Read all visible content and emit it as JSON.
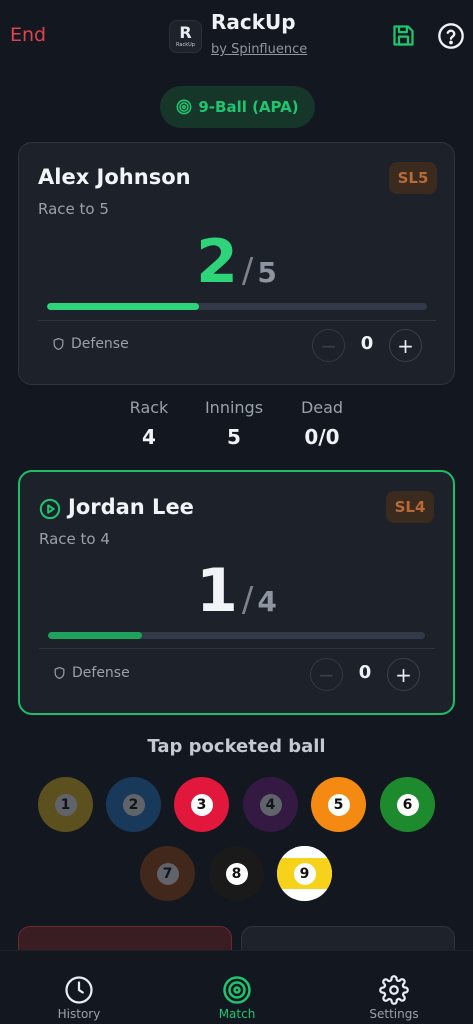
{
  "header": {
    "end_label": "End",
    "logo_text": "R",
    "logo_small": "RackUp",
    "app_title": "RackUp",
    "app_subtitle": "by Spinfluence"
  },
  "game_type": "9-Ball (APA)",
  "player1": {
    "name": "Alex Johnson",
    "skill_level": "SL5",
    "race_label": "Race to 5",
    "score": "2",
    "target": "5",
    "progress": 0.4,
    "defense_label": "Defense",
    "defense_count": "0"
  },
  "player2": {
    "name": "Jordan Lee",
    "skill_level": "SL4",
    "race_label": "Race to 4",
    "score": "1",
    "target": "4",
    "progress": 0.25,
    "defense_label": "Defense",
    "defense_count": "0",
    "active": true
  },
  "stats": {
    "rack_label": "Rack",
    "rack_value": "4",
    "innings_label": "Innings",
    "innings_value": "5",
    "dead_label": "Dead",
    "dead_value": "0/0"
  },
  "tap_label": "Tap pocketed ball",
  "balls": [
    {
      "number": "1",
      "color": "#f3c81b",
      "pocketed": true
    },
    {
      "number": "2",
      "color": "#2a7fd4",
      "pocketed": true
    },
    {
      "number": "3",
      "color": "#e1173c",
      "pocketed": false
    },
    {
      "number": "4",
      "color": "#7a1e8c",
      "pocketed": true
    },
    {
      "number": "5",
      "color": "#f58a12",
      "pocketed": false
    },
    {
      "number": "6",
      "color": "#1e8a2e",
      "pocketed": false
    },
    {
      "number": "7",
      "color": "#a34a12",
      "pocketed": true
    },
    {
      "number": "8",
      "color": "#1a1a1a",
      "pocketed": false
    },
    {
      "number": "9",
      "color": "#f7d21a",
      "pocketed": false,
      "stripe": true
    }
  ],
  "colors": {
    "accent_green": "#1fc46f",
    "score_green": "#2ed47a",
    "danger_red": "#e0434b",
    "sl_orange": "#b86a36"
  },
  "nav": {
    "history_label": "History",
    "match_label": "Match",
    "settings_label": "Settings"
  }
}
